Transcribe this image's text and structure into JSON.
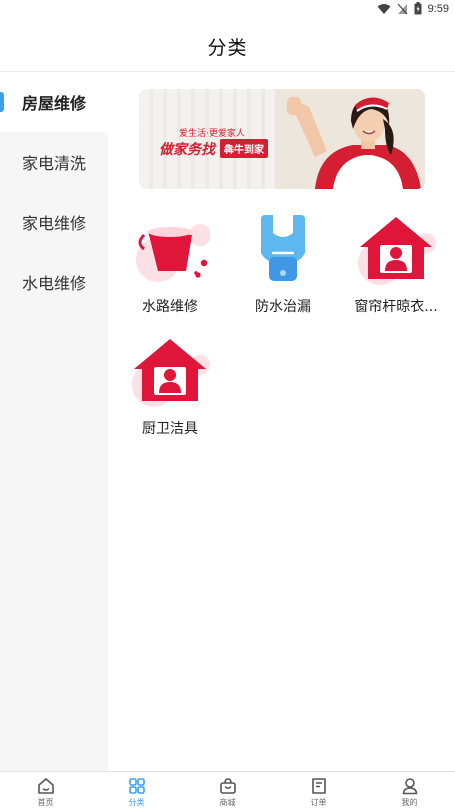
{
  "status_bar": {
    "time": "9:59"
  },
  "header": {
    "title": "分类"
  },
  "sidebar": {
    "items": [
      {
        "label": "房屋维修",
        "active": true
      },
      {
        "label": "家电清洗",
        "active": false
      },
      {
        "label": "家电维修",
        "active": false
      },
      {
        "label": "水电维修",
        "active": false
      }
    ]
  },
  "banner": {
    "slogan_small": "爱生活·更爱家人",
    "slogan_big": "做家务找",
    "brand": "犇牛到家"
  },
  "services": [
    {
      "label": "水路维修",
      "icon": "water-bucket-icon"
    },
    {
      "label": "防水治漏",
      "icon": "wrench-icon"
    },
    {
      "label": "窗帘杆晾衣...",
      "icon": "house-person-icon"
    },
    {
      "label": "厨卫洁具",
      "icon": "house-person-icon"
    }
  ],
  "tabbar": {
    "items": [
      {
        "label": "首页",
        "icon": "home-icon"
      },
      {
        "label": "分类",
        "icon": "category-grid-icon",
        "active": true
      },
      {
        "label": "商城",
        "icon": "shopping-bag-icon"
      },
      {
        "label": "订单",
        "icon": "order-icon"
      },
      {
        "label": "我的",
        "icon": "profile-icon"
      }
    ]
  },
  "colors": {
    "accent": "#3aa0ee",
    "brand_red": "#d61e32",
    "pink_blob": "#fbe0e6",
    "sidebar_bg": "#f6f6f6"
  }
}
